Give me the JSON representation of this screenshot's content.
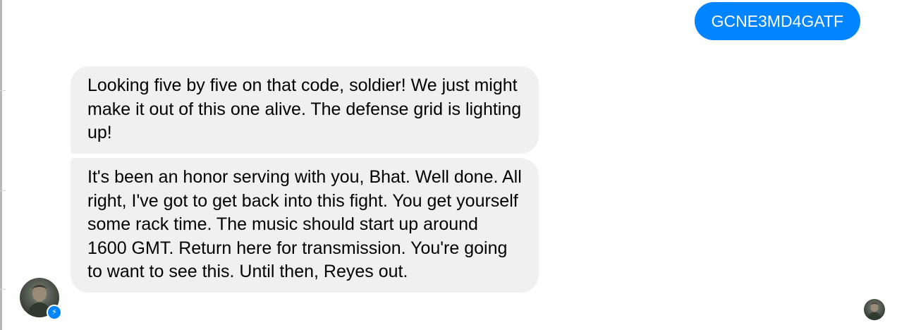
{
  "conversation": {
    "sent_messages": [
      {
        "text": "GCNE3MD4GATF"
      }
    ],
    "received_messages": [
      {
        "text": "Looking five by five on that code, soldier! We just might make it out of this one alive. The defense grid is lighting up!"
      },
      {
        "text": "It's been an honor serving with you, Bhat. Well done. All right, I've got to get back into this fight. You get yourself some rack time. The music should start up around 1600 GMT. Return here for transmission. You're going to want to see this. Until then, Reyes out."
      }
    ]
  },
  "icons": {
    "avatar": "contact-avatar-photo",
    "badge": "messenger-bolt-icon",
    "read_receipt": "seen-avatar-photo"
  },
  "colors": {
    "sent_bubble": "#0084ff",
    "received_bubble": "#f1f0f0",
    "badge": "#0084ff"
  }
}
